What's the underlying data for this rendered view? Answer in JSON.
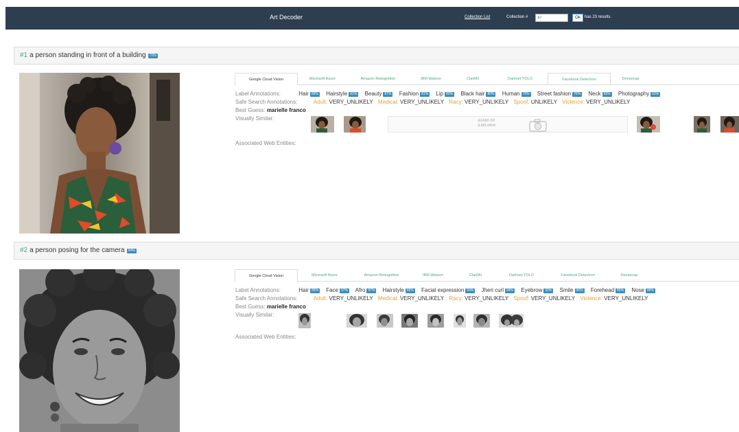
{
  "navbar": {
    "title": "Art Decoder",
    "collection_list_link": "Collection List",
    "collection_label": "Collection #",
    "collection_value": "37",
    "ok_label": "Ok",
    "results_text": "has 23 results."
  },
  "tabs": [
    "Google Cloud Vision",
    "Microsoft Azure",
    "Amazon Rekognition",
    "IBM Watson",
    "ClarifAI",
    "Darknet YOLO",
    "Facebook Detectron",
    "Densecap"
  ],
  "field_labels": {
    "label_annotations": "Label Annotations:",
    "safe_search": "Safe Search Annotations:",
    "best_guess": "Best Guess:",
    "visually_similar": "Visually Similar:",
    "web_entities": "Associated Web Entities:"
  },
  "no_image_text": {
    "line1": "NO IMAGE",
    "line2": "AVAILABLE"
  },
  "results": [
    {
      "number": "#1",
      "caption": "a person standing in front of a building",
      "confidence": "71%",
      "labels": [
        {
          "name": "Hair",
          "score": "99%"
        },
        {
          "name": "Hairstyle",
          "score": "91%"
        },
        {
          "name": "Beauty",
          "score": "87%"
        },
        {
          "name": "Fashion",
          "score": "81%"
        },
        {
          "name": "Lip",
          "score": "80%"
        },
        {
          "name": "Black hair",
          "score": "80%"
        },
        {
          "name": "Human",
          "score": "79%"
        },
        {
          "name": "Street fashion",
          "score": "76%"
        },
        {
          "name": "Neck",
          "score": "65%"
        },
        {
          "name": "Photography",
          "score": "62%"
        }
      ],
      "safe_search": [
        {
          "key": "Adult:",
          "value": "VERY_UNLIKELY"
        },
        {
          "key": "Medical:",
          "value": "VERY_UNLIKELY"
        },
        {
          "key": "Racy:",
          "value": "VERY_UNLIKELY"
        },
        {
          "key": "Spoof:",
          "value": "UNLIKELY"
        },
        {
          "key": "Violence:",
          "value": "VERY_UNLIKELY"
        }
      ],
      "best_guess": "marielle franco"
    },
    {
      "number": "#2",
      "caption": "a person posing for the camera",
      "confidence": "94%",
      "labels": [
        {
          "name": "Hair",
          "score": "99%"
        },
        {
          "name": "Face",
          "score": "97%"
        },
        {
          "name": "Afro",
          "score": "97%"
        },
        {
          "name": "Hairstyle",
          "score": "96%"
        },
        {
          "name": "Facial expression",
          "score": "94%"
        },
        {
          "name": "Jheri curl",
          "score": "94%"
        },
        {
          "name": "Eyebrow",
          "score": "92%"
        },
        {
          "name": "Smile",
          "score": "90%"
        },
        {
          "name": "Forehead",
          "score": "85%"
        },
        {
          "name": "Nose",
          "score": "84%"
        }
      ],
      "safe_search": [
        {
          "key": "Adult:",
          "value": "VERY_UNLIKELY"
        },
        {
          "key": "Medical:",
          "value": "VERY_UNLIKELY"
        },
        {
          "key": "Racy:",
          "value": "VERY_UNLIKELY"
        },
        {
          "key": "Spoof:",
          "value": "VERY_UNLIKELY"
        },
        {
          "key": "Violence:",
          "value": "VERY_UNLIKELY"
        }
      ],
      "best_guess": "marielle franco"
    }
  ]
}
